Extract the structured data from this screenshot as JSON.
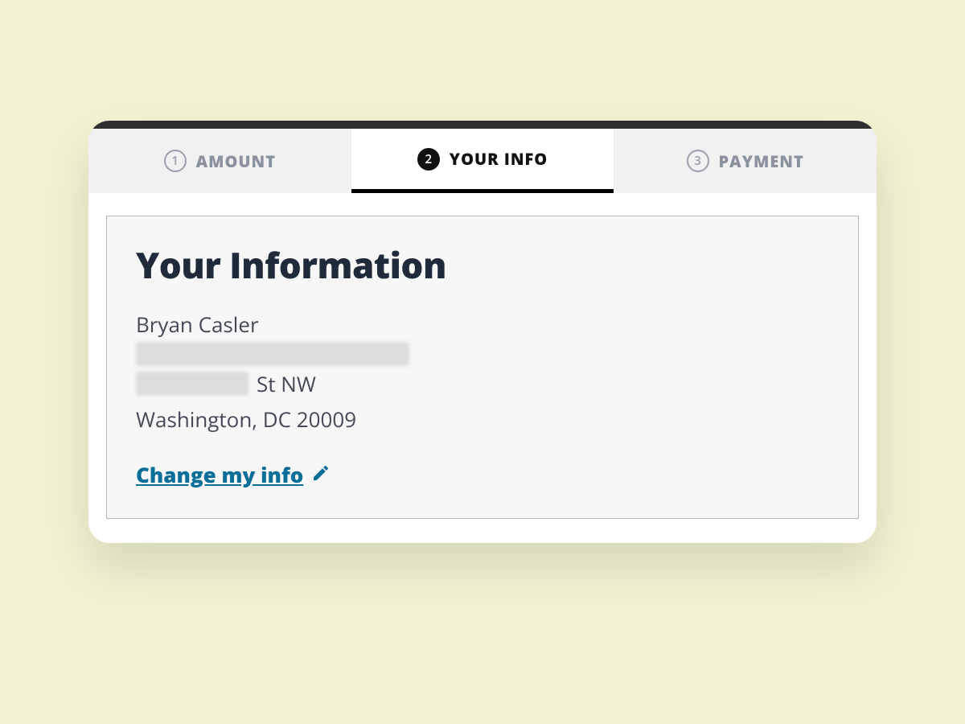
{
  "tabs": [
    {
      "num": "1",
      "label": "AMOUNT",
      "active": false
    },
    {
      "num": "2",
      "label": "YOUR INFO",
      "active": true
    },
    {
      "num": "3",
      "label": "PAYMENT",
      "active": false
    }
  ],
  "info": {
    "heading": "Your Information",
    "name": "Bryan Casler",
    "street_suffix": "St NW",
    "city_line": "Washington, DC 20009",
    "change_link": "Change my info"
  }
}
